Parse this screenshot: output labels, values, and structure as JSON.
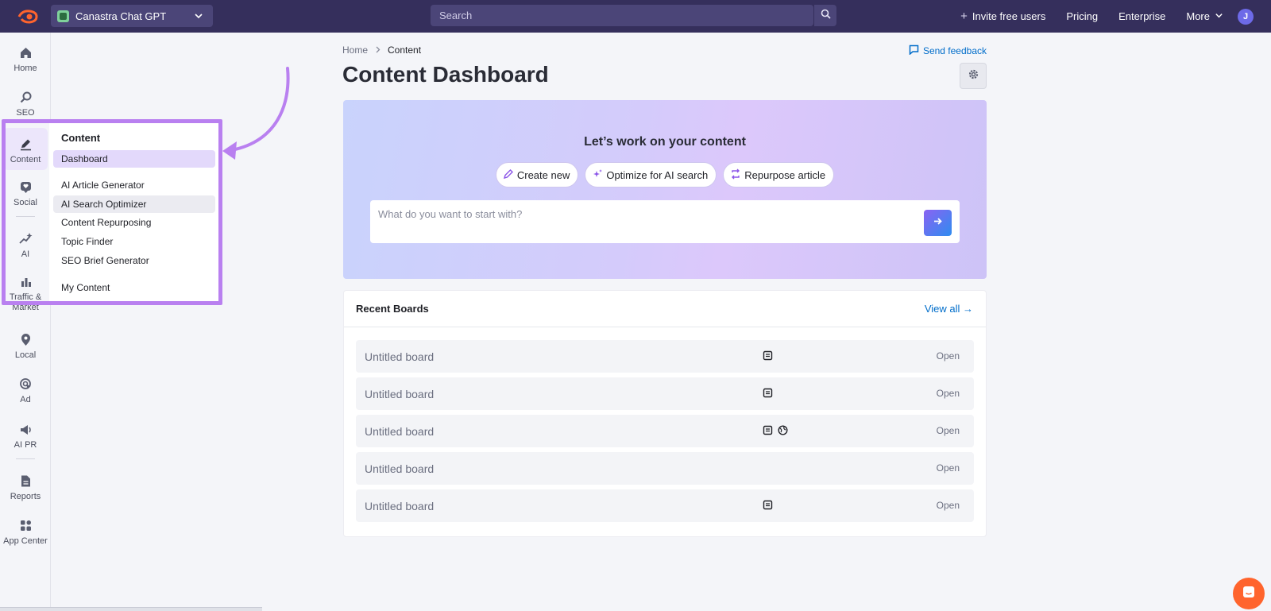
{
  "topbar": {
    "project_name": "Canastra Chat GPT",
    "search_placeholder": "Search",
    "invite_label": "Invite free users",
    "pricing_label": "Pricing",
    "enterprise_label": "Enterprise",
    "more_label": "More",
    "avatar_initial": "J"
  },
  "rail": {
    "items": [
      {
        "label": "Home",
        "icon": "home-icon"
      },
      {
        "label": "SEO",
        "icon": "seo-icon"
      },
      {
        "label": "Content",
        "icon": "pencil-icon"
      },
      {
        "label": "Social",
        "icon": "heart-bubble-icon"
      },
      {
        "label": "AI",
        "icon": "sparkle-icon"
      },
      {
        "label": "Traffic & Market",
        "icon": "bar-chart-icon"
      },
      {
        "label": "Local",
        "icon": "map-pin-icon"
      },
      {
        "label": "Ad",
        "icon": "target-cursor-icon"
      },
      {
        "label": "AI PR",
        "icon": "megaphone-icon"
      },
      {
        "label": "Reports",
        "icon": "document-icon"
      },
      {
        "label": "App Center",
        "icon": "apps-grid-icon"
      }
    ]
  },
  "flyout": {
    "title": "Content",
    "items": [
      "Dashboard",
      "AI Article Generator",
      "AI Search Optimizer",
      "Content Repurposing",
      "Topic Finder",
      "SEO Brief Generator",
      "My Content"
    ]
  },
  "main": {
    "breadcrumb": [
      "Home",
      "Content"
    ],
    "feedback_label": "Send feedback",
    "title": "Content Dashboard",
    "hero": {
      "title": "Let’s work on your content",
      "chips": [
        "Create new",
        "Optimize for AI search",
        "Repurpose article"
      ],
      "prompt_placeholder": "What do you want to start with?"
    },
    "boards": {
      "title": "Recent Boards",
      "view_all": "View all →",
      "open_label": "Open",
      "rows": [
        {
          "name": "Untitled board",
          "icons": [
            "doc"
          ]
        },
        {
          "name": "Untitled board",
          "icons": [
            "doc"
          ]
        },
        {
          "name": "Untitled board",
          "icons": [
            "doc",
            "globe"
          ]
        },
        {
          "name": "Untitled board",
          "icons": []
        },
        {
          "name": "Untitled board",
          "icons": [
            "doc"
          ]
        }
      ]
    }
  },
  "colors": {
    "topbar_bg": "#352f5c",
    "accent_purple": "#b980f0",
    "link_blue": "#006dca",
    "brand_orange": "#ff642d"
  }
}
